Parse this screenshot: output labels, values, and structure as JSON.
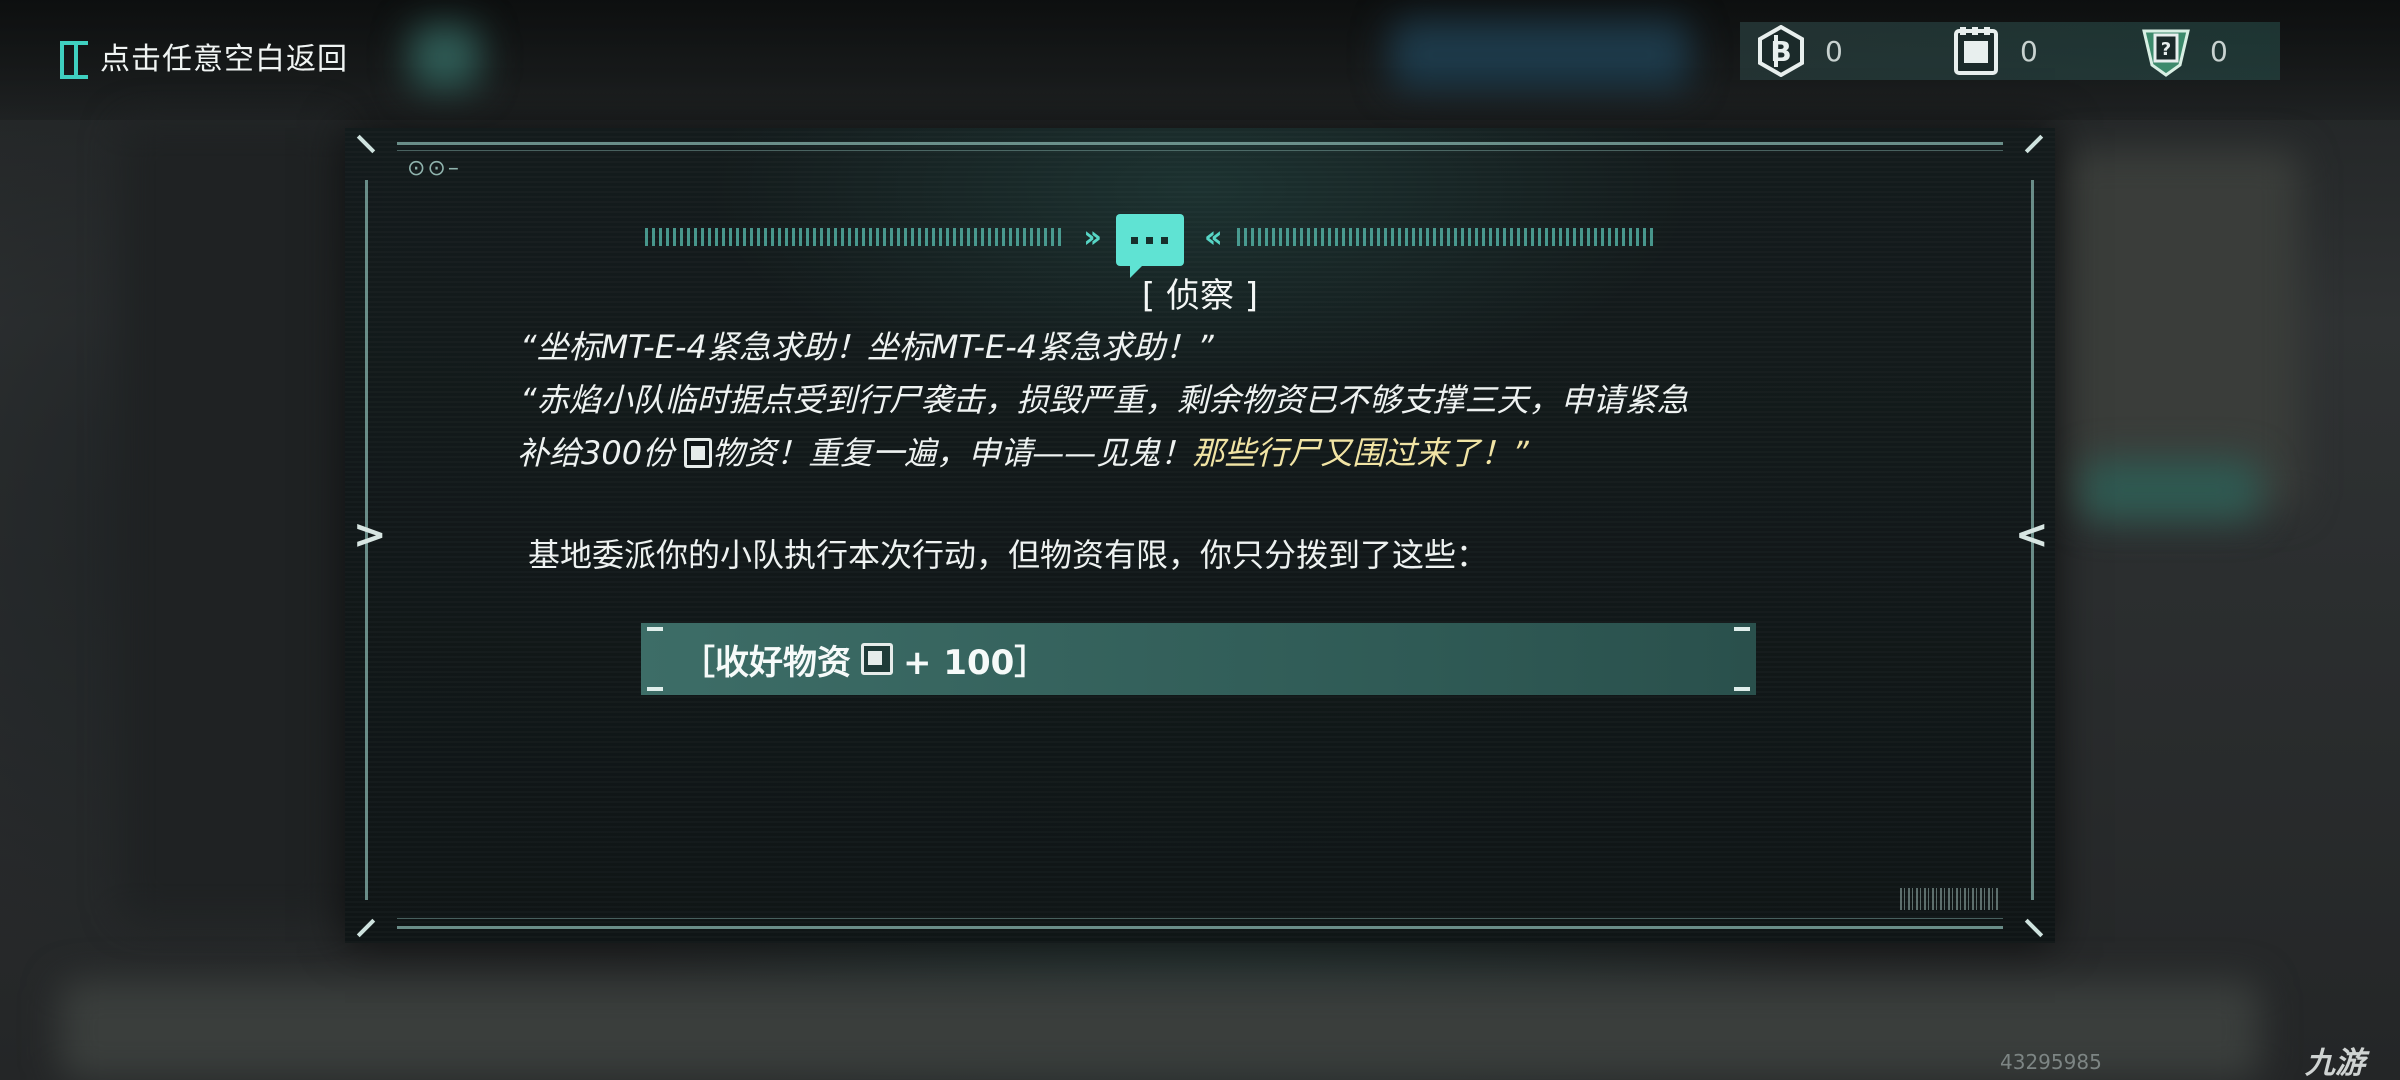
{
  "topbar": {
    "back_label": "点击任意空白返回",
    "resources": [
      {
        "icon": "coin-icon",
        "value": "0"
      },
      {
        "icon": "supply-crate-icon",
        "value": "0"
      },
      {
        "icon": "mystery-card-icon",
        "value": "0"
      }
    ]
  },
  "dialog": {
    "title": "[ 侦察 ]",
    "quote_line1": "“坐标MT-E-4紧急求助！坐标MT-E-4紧急求助！”",
    "quote_line2": "“赤焰小队临时据点受到行尸袭击，损毁严重，剩余物资已不够支撑三天，申请紧急",
    "quote_line3_a": "补给300份 ",
    "quote_line3_b": "物资！重复一遍，申请——见鬼！",
    "quote_line3_c": "那些行尸又围过来了！”",
    "body": "基地委派你的小队执行本次行动，但物资有限，你只分拨到了这些：",
    "reward_prefix": "［收好物资",
    "reward_suffix": "+ 100］",
    "side_left": ">",
    "side_right": "<",
    "header_dots": "⊙⊙–"
  },
  "watermark": {
    "id": "43295985",
    "logo": "九游"
  },
  "colors": {
    "accent": "#5fe3d3",
    "highlight_text": "#f1e4a4",
    "button_bg": "#3d6d67"
  }
}
